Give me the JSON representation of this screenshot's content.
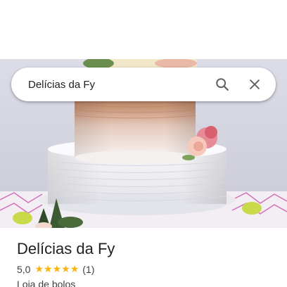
{
  "search": {
    "query": "Delícias da Fy",
    "search_icon": "search-icon",
    "close_icon": "close-icon"
  },
  "place": {
    "title": "Delícias da Fy",
    "rating": "5,0",
    "stars": 5,
    "review_count": "(1)",
    "category": "Loja de bolos",
    "photo": "cake-photo"
  },
  "colors": {
    "star": "#f6b40e",
    "text_primary": "#202124",
    "text_secondary": "#3c4043",
    "icon": "#5f6368"
  }
}
